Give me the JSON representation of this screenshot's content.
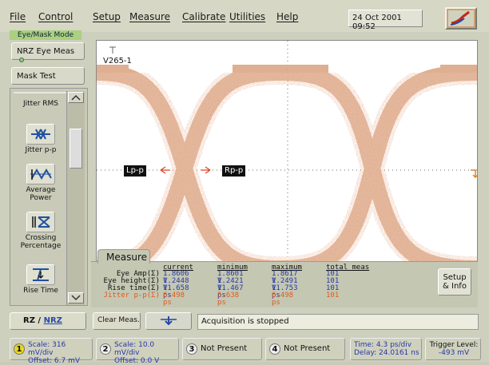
{
  "menu": {
    "items": [
      "File",
      "Control",
      "Setup",
      "Measure",
      "Calibrate",
      "Utilities",
      "Help"
    ]
  },
  "datetime": "24 Oct 2001  09:52",
  "mode": "Eye/Mask Mode",
  "left": {
    "nrz_eye": "NRZ Eye Meas",
    "mask_test": "Mask Test",
    "jitter_rms": "Jitter RMS",
    "jitter_pp": "Jitter p-p",
    "avg_power": "Average Power",
    "crossing": "Crossing Percentage",
    "rise_time": "Rise Time",
    "rz_nrz_a": "RZ / ",
    "rz_nrz_b": "NRZ"
  },
  "screen": {
    "vscale_label": "V265-1",
    "lpp": "Lp-p",
    "rpp": "Rp-p"
  },
  "measure": {
    "tab": "Measure",
    "headers": [
      "current",
      "minimum",
      "maximum",
      "total meas"
    ],
    "rows": [
      {
        "name": "Eye Amp(Σ)",
        "current": "1.8606 V",
        "minimum": "1.8601 V",
        "maximum": "1.8617 V",
        "total": "101",
        "color": "#111111"
      },
      {
        "name": "Eye height(Σ)",
        "current": "1.2448 V",
        "minimum": "1.2421 V",
        "maximum": "1.2491 V",
        "total": "101",
        "color": "#111111"
      },
      {
        "name": "Rise time(Σ)",
        "current": "11.658 ps",
        "minimum": "11.467 ps",
        "maximum": "11.753 ps",
        "total": "101",
        "color": "#111111"
      },
      {
        "name": "Jitter p-p(Σ)",
        "current": "6.498 ps",
        "minimum": "5.638 ps",
        "maximum": "6.498 ps",
        "total": "101",
        "color": "#e05a20"
      }
    ],
    "setup_a": "Setup",
    "setup_b": "& Info"
  },
  "bottom": {
    "clear": "Clear Meas.",
    "status": "Acquisition is stopped"
  },
  "channels": [
    {
      "num": "1",
      "l1": "Scale: 316 mV/div",
      "l2": "Offset: 6.7 mV",
      "color": "#e8d820"
    },
    {
      "num": "2",
      "l1": "Scale: 10.0 mV/div",
      "l2": "Offset: 0.0 V",
      "color": "#eeeeee"
    },
    {
      "num": "3",
      "l1": "Not Present",
      "l2": "",
      "color": "#eeeeee"
    },
    {
      "num": "4",
      "l1": "Not Present",
      "l2": "",
      "color": "#eeeeee"
    }
  ],
  "timebase": {
    "l1": "Time:  4.3 ps/div",
    "l2": "Delay: 24.0161 ns"
  },
  "trigger": {
    "l1": "Trigger Level:",
    "l2": "-493 mV"
  },
  "colors": {
    "eye": "#d9a27e",
    "accent": "#e8d820",
    "blue_value": "#2838a8",
    "jitter": "#e05a20"
  }
}
